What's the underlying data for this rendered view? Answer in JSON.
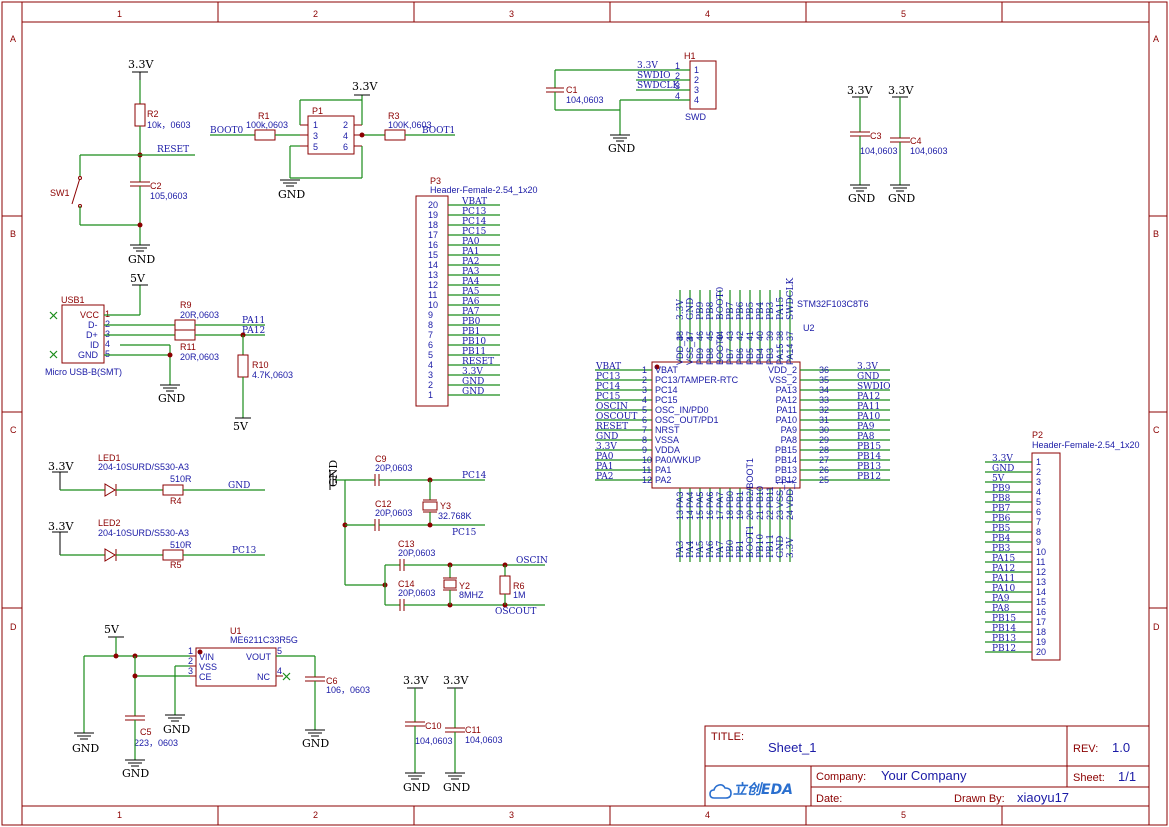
{
  "border": {
    "columns": [
      "1",
      "2",
      "3",
      "4",
      "5"
    ],
    "rows": [
      "A",
      "B",
      "C",
      "D"
    ]
  },
  "title_block": {
    "title_label": "TITLE:",
    "title_value": "Sheet_1",
    "rev_label": "REV:",
    "rev_value": "1.0",
    "company_label": "Company:",
    "company_value": "Your Company",
    "sheet_label": "Sheet:",
    "sheet_value": "1/1",
    "date_label": "Date:",
    "date_value": "",
    "drawn_label": "Drawn By:",
    "drawn_value": "xiaoyu17",
    "logo_text": "立创EDA"
  },
  "components": {
    "r2": {
      "ref": "R2",
      "val": "10k，0603"
    },
    "c2": {
      "ref": "C2",
      "val": "105,0603"
    },
    "sw1": {
      "ref": "SW1"
    },
    "r1": {
      "ref": "R1",
      "val": "100k,0603"
    },
    "p1": {
      "ref": "P1",
      "pins": [
        "1",
        "2",
        "3",
        "4",
        "5",
        "6"
      ]
    },
    "r3": {
      "ref": "R3",
      "val": "100K,0603"
    },
    "c1": {
      "ref": "C1",
      "val": "104,0603"
    },
    "h1": {
      "ref": "H1",
      "name": "SWD",
      "pins": [
        "1",
        "2",
        "3",
        "4"
      ],
      "nets": [
        "3.3V",
        "SWDIO",
        "SWDCLK",
        ""
      ]
    },
    "c3": {
      "ref": "C3",
      "val": "104,0603"
    },
    "c4": {
      "ref": "C4",
      "val": "104,0603"
    },
    "usb1": {
      "ref": "USB1",
      "name": "Micro USB-B(SMT)",
      "pins": [
        "VCC",
        "D-",
        "D+",
        "ID",
        "GND"
      ],
      "nums": [
        "1",
        "2",
        "3",
        "4",
        "5"
      ]
    },
    "r9": {
      "ref": "R9",
      "val": "20R,0603"
    },
    "r11": {
      "ref": "R11",
      "val": "20R,0603"
    },
    "r10": {
      "ref": "R10",
      "val": "4.7K,0603"
    },
    "p3": {
      "ref": "P3",
      "name": "Header-Female-2.54_1x20"
    },
    "p2": {
      "ref": "P2",
      "name": "Header-Female-2.54_1x20"
    },
    "led1": {
      "ref": "LED1",
      "val": "204-10SURD/S530-A3"
    },
    "r4": {
      "ref": "R4",
      "val": "510R"
    },
    "led2": {
      "ref": "LED2",
      "val": "204-10SURD/S530-A3"
    },
    "r5": {
      "ref": "R5",
      "val": "510R"
    },
    "c9": {
      "ref": "C9",
      "val": "20P,0603"
    },
    "c12": {
      "ref": "C12",
      "val": "20P,0603"
    },
    "y3": {
      "ref": "Y3",
      "val": "32.768K"
    },
    "c13": {
      "ref": "C13",
      "val": "20P,0603"
    },
    "c14": {
      "ref": "C14",
      "val": "20P,0603"
    },
    "y2": {
      "ref": "Y2",
      "val": "8MHZ"
    },
    "r6": {
      "ref": "R6",
      "val": "1M"
    },
    "u1": {
      "ref": "U1",
      "val": "ME6211C33R5G",
      "pins": [
        "VIN",
        "VSS",
        "CE",
        "VOUT",
        "NC"
      ],
      "nums": [
        "1",
        "2",
        "3",
        "5",
        "4"
      ]
    },
    "c5": {
      "ref": "C5",
      "val": "223，0603"
    },
    "c6": {
      "ref": "C6",
      "val": "106，0603"
    },
    "c10": {
      "ref": "C10",
      "val": "104,0603"
    },
    "c11": {
      "ref": "C11",
      "val": "104,0603"
    },
    "u2": {
      "ref": "U2",
      "val": "STM32F103C8T6"
    }
  },
  "nets": {
    "v33": "3.3V",
    "v5": "5V",
    "gnd": "GND",
    "reset": "RESET",
    "boot0": "BOOT0",
    "boot1": "BOOT1",
    "pa11": "PA11",
    "pa12": "PA12",
    "pc13": "PC13",
    "pc14": "PC14",
    "pc15": "PC15",
    "oscin": "OSCIN",
    "oscout": "OSCOUT"
  },
  "p3_rows": [
    {
      "n": "20",
      "net": "VBAT"
    },
    {
      "n": "19",
      "net": "PC13"
    },
    {
      "n": "18",
      "net": "PC14"
    },
    {
      "n": "17",
      "net": "PC15"
    },
    {
      "n": "16",
      "net": "PA0"
    },
    {
      "n": "15",
      "net": "PA1"
    },
    {
      "n": "14",
      "net": "PA2"
    },
    {
      "n": "13",
      "net": "PA3"
    },
    {
      "n": "12",
      "net": "PA4"
    },
    {
      "n": "11",
      "net": "PA5"
    },
    {
      "n": "10",
      "net": "PA6"
    },
    {
      "n": "9",
      "net": "PA7"
    },
    {
      "n": "8",
      "net": "PB0"
    },
    {
      "n": "7",
      "net": "PB1"
    },
    {
      "n": "6",
      "net": "PB10"
    },
    {
      "n": "5",
      "net": "PB11"
    },
    {
      "n": "4",
      "net": "RESET"
    },
    {
      "n": "3",
      "net": "3.3V"
    },
    {
      "n": "2",
      "net": "GND"
    },
    {
      "n": "1",
      "net": "GND"
    }
  ],
  "p2_rows": [
    {
      "n": "1",
      "net": "3.3V"
    },
    {
      "n": "2",
      "net": "GND"
    },
    {
      "n": "3",
      "net": "5V"
    },
    {
      "n": "4",
      "net": "PB9"
    },
    {
      "n": "5",
      "net": "PB8"
    },
    {
      "n": "6",
      "net": "PB7"
    },
    {
      "n": "7",
      "net": "PB6"
    },
    {
      "n": "8",
      "net": "PB5"
    },
    {
      "n": "9",
      "net": "PB4"
    },
    {
      "n": "10",
      "net": "PB3"
    },
    {
      "n": "11",
      "net": "PA15"
    },
    {
      "n": "12",
      "net": "PA12"
    },
    {
      "n": "13",
      "net": "PA11"
    },
    {
      "n": "14",
      "net": "PA10"
    },
    {
      "n": "15",
      "net": "PA9"
    },
    {
      "n": "16",
      "net": "PA8"
    },
    {
      "n": "17",
      "net": "PB15"
    },
    {
      "n": "18",
      "net": "PB14"
    },
    {
      "n": "19",
      "net": "PB13"
    },
    {
      "n": "20",
      "net": "PB12"
    }
  ],
  "u2_left": [
    {
      "n": "1",
      "pin": "VBAT",
      "net": "VBAT"
    },
    {
      "n": "2",
      "pin": "PC13/TAMPER-RTC",
      "net": "PC13"
    },
    {
      "n": "3",
      "pin": "PC14",
      "net": "PC14"
    },
    {
      "n": "4",
      "pin": "PC15",
      "net": "PC15"
    },
    {
      "n": "5",
      "pin": "OSC_IN/PD0",
      "net": "OSCIN"
    },
    {
      "n": "6",
      "pin": "OSC_OUT/PD1",
      "net": "OSCOUT"
    },
    {
      "n": "7",
      "pin": "NRST",
      "net": "RESET"
    },
    {
      "n": "8",
      "pin": "VSSA",
      "net": "GND"
    },
    {
      "n": "9",
      "pin": "VDDA",
      "net": "3.3V"
    },
    {
      "n": "10",
      "pin": "PA0/WKUP",
      "net": "PA0"
    },
    {
      "n": "11",
      "pin": "PA1",
      "net": "PA1"
    },
    {
      "n": "12",
      "pin": "PA2",
      "net": "PA2"
    }
  ],
  "u2_right": [
    {
      "n": "36",
      "pin": "VDD_2",
      "net": "3.3V"
    },
    {
      "n": "35",
      "pin": "VSS_2",
      "net": "GND"
    },
    {
      "n": "34",
      "pin": "PA13",
      "net": "SWDIO"
    },
    {
      "n": "33",
      "pin": "PA12",
      "net": "PA12"
    },
    {
      "n": "32",
      "pin": "PA11",
      "net": "PA11"
    },
    {
      "n": "31",
      "pin": "PA10",
      "net": "PA10"
    },
    {
      "n": "30",
      "pin": "PA9",
      "net": "PA9"
    },
    {
      "n": "29",
      "pin": "PA8",
      "net": "PA8"
    },
    {
      "n": "28",
      "pin": "PB15",
      "net": "PB15"
    },
    {
      "n": "27",
      "pin": "PB14",
      "net": "PB14"
    },
    {
      "n": "26",
      "pin": "PB13",
      "net": "PB13"
    },
    {
      "n": "25",
      "pin": "PB12",
      "net": "PB12"
    }
  ],
  "u2_top": [
    {
      "n": "48",
      "pin": "VDD_3",
      "net": "3.3V"
    },
    {
      "n": "47",
      "pin": "VSS_3",
      "net": "GND"
    },
    {
      "n": "46",
      "pin": "PB9",
      "net": "PB9"
    },
    {
      "n": "45",
      "pin": "PB8",
      "net": "PB8"
    },
    {
      "n": "44",
      "pin": "BOOT0",
      "net": "BOOT0"
    },
    {
      "n": "43",
      "pin": "PB7",
      "net": "PB7"
    },
    {
      "n": "42",
      "pin": "PB6",
      "net": "PB6"
    },
    {
      "n": "41",
      "pin": "PB5",
      "net": "PB5"
    },
    {
      "n": "40",
      "pin": "PB4",
      "net": "PB4"
    },
    {
      "n": "39",
      "pin": "PB3",
      "net": "PB3"
    },
    {
      "n": "38",
      "pin": "PA15",
      "net": "PA15"
    },
    {
      "n": "37",
      "pin": "PA14",
      "net": "SWDCLK"
    }
  ],
  "u2_bottom": [
    {
      "n": "13",
      "pin": "PA3",
      "net": "PA3"
    },
    {
      "n": "14",
      "pin": "PA4",
      "net": "PA4"
    },
    {
      "n": "15",
      "pin": "PA5",
      "net": "PA5"
    },
    {
      "n": "16",
      "pin": "PA6",
      "net": "PA6"
    },
    {
      "n": "17",
      "pin": "PA7",
      "net": "PA7"
    },
    {
      "n": "18",
      "pin": "PB0",
      "net": "PB0"
    },
    {
      "n": "19",
      "pin": "PB1",
      "net": "PB1"
    },
    {
      "n": "20",
      "pin": "PB2/BOOT1",
      "net": "BOOT1"
    },
    {
      "n": "21",
      "pin": "PB10",
      "net": "PB10"
    },
    {
      "n": "22",
      "pin": "PB11",
      "net": "PB11"
    },
    {
      "n": "23",
      "pin": "VSS_1",
      "net": "GND"
    },
    {
      "n": "24",
      "pin": "VDD_1",
      "net": "3.3V"
    }
  ]
}
